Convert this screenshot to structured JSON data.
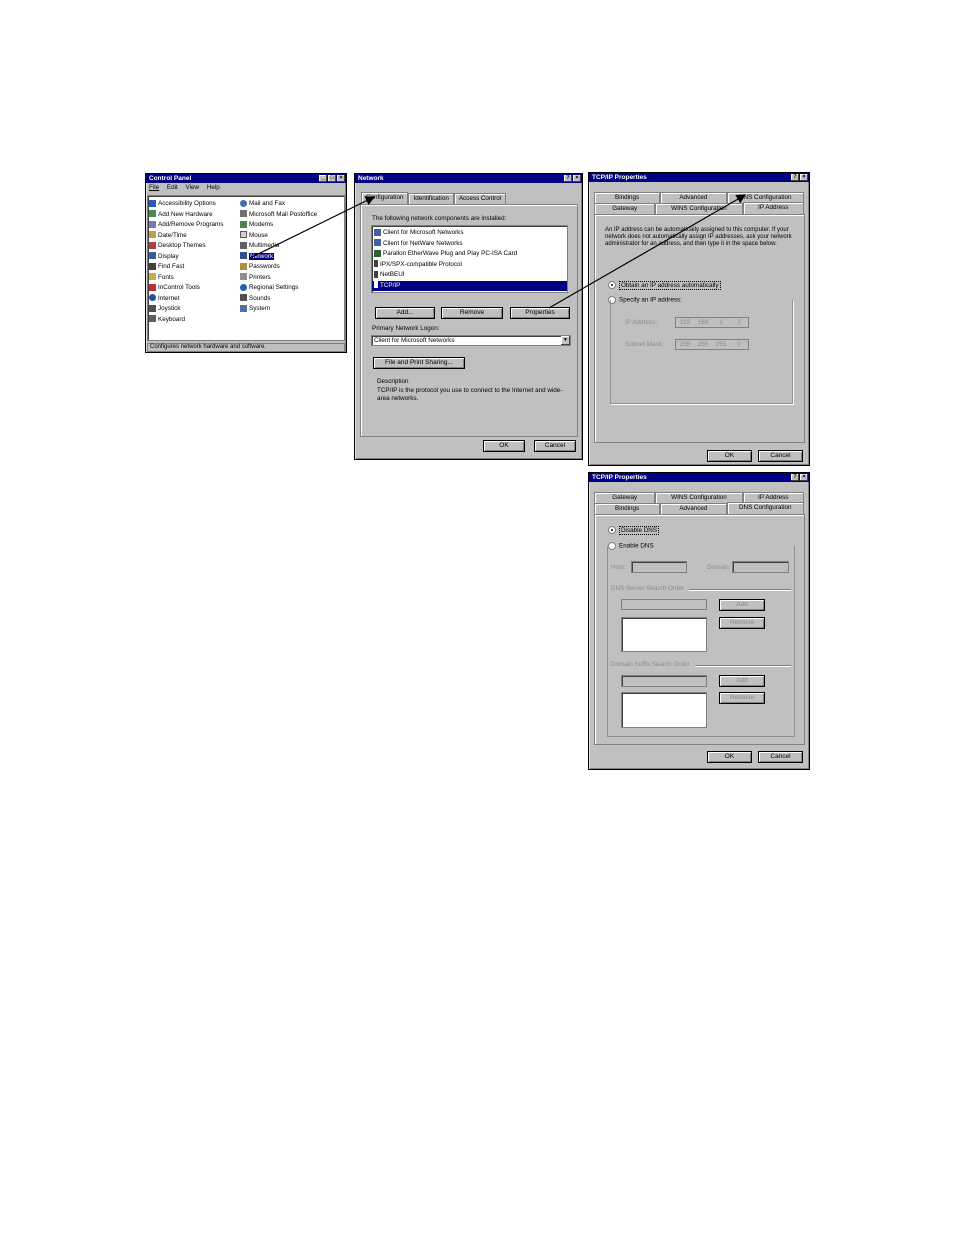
{
  "control_panel": {
    "title": "Control Panel",
    "menu": [
      "File",
      "Edit",
      "View",
      "Help"
    ],
    "col1": [
      "Accessibility Options",
      "Add New Hardware",
      "Add/Remove Programs",
      "Date/Time",
      "Desktop Themes",
      "Display",
      "Find Fast",
      "Fonts",
      "InControl Tools",
      "Internet",
      "Joystick",
      "Keyboard"
    ],
    "col2": [
      "Mail and Fax",
      "Microsoft Mail Postoffice",
      "Modems",
      "Mouse",
      "Multimedia",
      "Network",
      "Passwords",
      "Printers",
      "Regional Settings",
      "Sounds",
      "System"
    ],
    "status": "Configures network hardware and software."
  },
  "network": {
    "title": "Network",
    "tabs": [
      "Configuration",
      "Identification",
      "Access Control"
    ],
    "components_label": "The following network components are installed:",
    "components": [
      "Client for Microsoft Networks",
      "Client for NetWare Networks",
      "Parallon EtherWave Plug and Play PC-ISA Card",
      "IPX/SPX-compatible Protocol",
      "NetBEUI",
      "TCP/IP"
    ],
    "add": "Add...",
    "remove": "Remove",
    "properties": "Properties",
    "logon_label": "Primary Network Logon:",
    "logon_value": "Client for Microsoft Networks",
    "file_print": "File and Print Sharing...",
    "desc_title": "Description",
    "desc_text": "TCP/IP is the protocol you use to connect to the Internet and wide-area networks.",
    "ok": "OK",
    "cancel": "Cancel"
  },
  "tcpip1": {
    "title": "TCP/IP Properties",
    "tabs_back": [
      "Bindings",
      "Advanced",
      "DNS Configuration"
    ],
    "tabs_front": [
      "Gateway",
      "WINS Configuration",
      "IP Address"
    ],
    "info": "An IP address can be automatically assigned to this computer. If your network does not automatically assign IP addresses, ask your network administrator for an address, and then type it in the space below.",
    "auto": "Obtain an IP address automatically",
    "specify": "Specify an IP address:",
    "ip_label": "IP Address:",
    "ip": [
      "192",
      "168",
      "1",
      "2"
    ],
    "mask_label": "Subnet Mask:",
    "mask": [
      "255",
      "255",
      "255",
      "0"
    ],
    "ok": "OK",
    "cancel": "Cancel"
  },
  "tcpip2": {
    "title": "TCP/IP Properties",
    "tabs_back": [
      "Gateway",
      "WINS Configuration",
      "IP Address"
    ],
    "tabs_front": [
      "Bindings",
      "Advanced",
      "DNS Configuration"
    ],
    "disable": "Disable DNS",
    "enable": "Enable DNS",
    "host": "Host:",
    "domain": "Domain:",
    "dns_order": "DNS Server Search Order",
    "domain_order": "Domain Suffix Search Order",
    "add": "Add",
    "remove": "Remove",
    "ok": "OK",
    "cancel": "Cancel"
  }
}
